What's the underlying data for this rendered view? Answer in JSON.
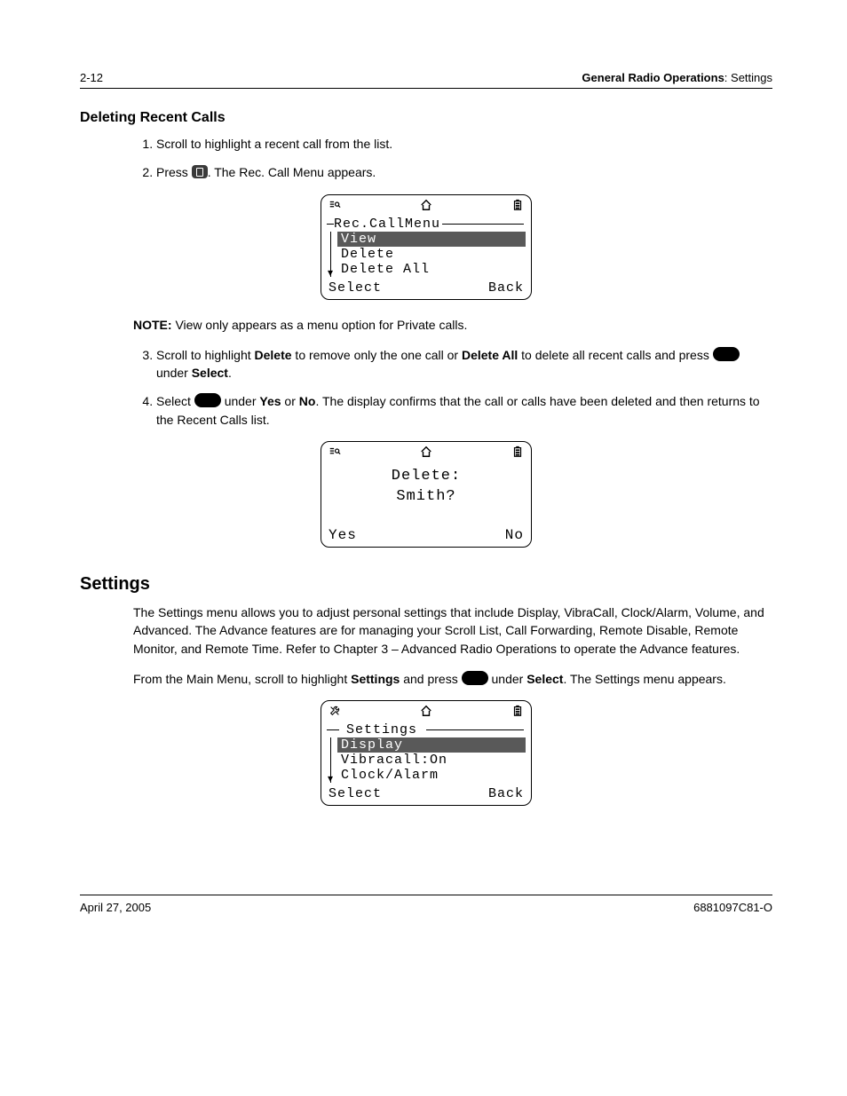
{
  "header": {
    "page_num": "2-12",
    "section_bold": "General Radio Operations",
    "section_rest": ": Settings"
  },
  "headings": {
    "deleting_recent_calls": "Deleting Recent Calls",
    "settings": "Settings"
  },
  "steps_a": {
    "s1": "Scroll to highlight a recent call from the list.",
    "s2_a": "Press ",
    "s2_b": ". The Rec. Call Menu appears."
  },
  "note": {
    "label": "NOTE:",
    "text": "View only appears as a menu option for Private calls."
  },
  "steps_b": {
    "s3_a": "Scroll to highlight ",
    "s3_b": "Delete",
    "s3_c": " to remove only the one call or ",
    "s3_d": "Delete All",
    "s3_e": " to delete all recent calls and press ",
    "s3_f": " under ",
    "s3_g": "Select",
    "s3_h": ".",
    "s4_a": "Select ",
    "s4_b": " under ",
    "s4_c": "Yes",
    "s4_d": " or ",
    "s4_e": "No",
    "s4_f": ". The display confirms that the call or calls have been deleted and then returns to the Recent Calls list."
  },
  "settings_para1": "The Settings menu allows you to adjust personal settings that include Display, VibraCall, Clock/Alarm, Volume, and Advanced. The Advance features are for managing your Scroll List, Call Forwarding, Remote Disable, Remote Monitor, and Remote Time. Refer to Chapter 3 – Advanced Radio Operations to operate the Advance features.",
  "settings_para2": {
    "a": "From the Main Menu, scroll to highlight ",
    "b": "Settings",
    "c": " and press ",
    "d": " under ",
    "e": "Select",
    "f": ". The Settings menu appears."
  },
  "lcd1": {
    "title": "Rec.CallMenu",
    "items": [
      "View",
      "Delete",
      "Delete All"
    ],
    "soft_left": "Select",
    "soft_right": "Back"
  },
  "lcd2": {
    "line1": "Delete:",
    "line2": "Smith?",
    "soft_left": "Yes",
    "soft_right": "No"
  },
  "lcd3": {
    "title": "Settings",
    "items": [
      "Display",
      "Vibracall:On",
      "Clock/Alarm"
    ],
    "soft_left": "Select",
    "soft_right": "Back"
  },
  "footer": {
    "date": "April 27, 2005",
    "docnum": "6881097C81-O"
  }
}
